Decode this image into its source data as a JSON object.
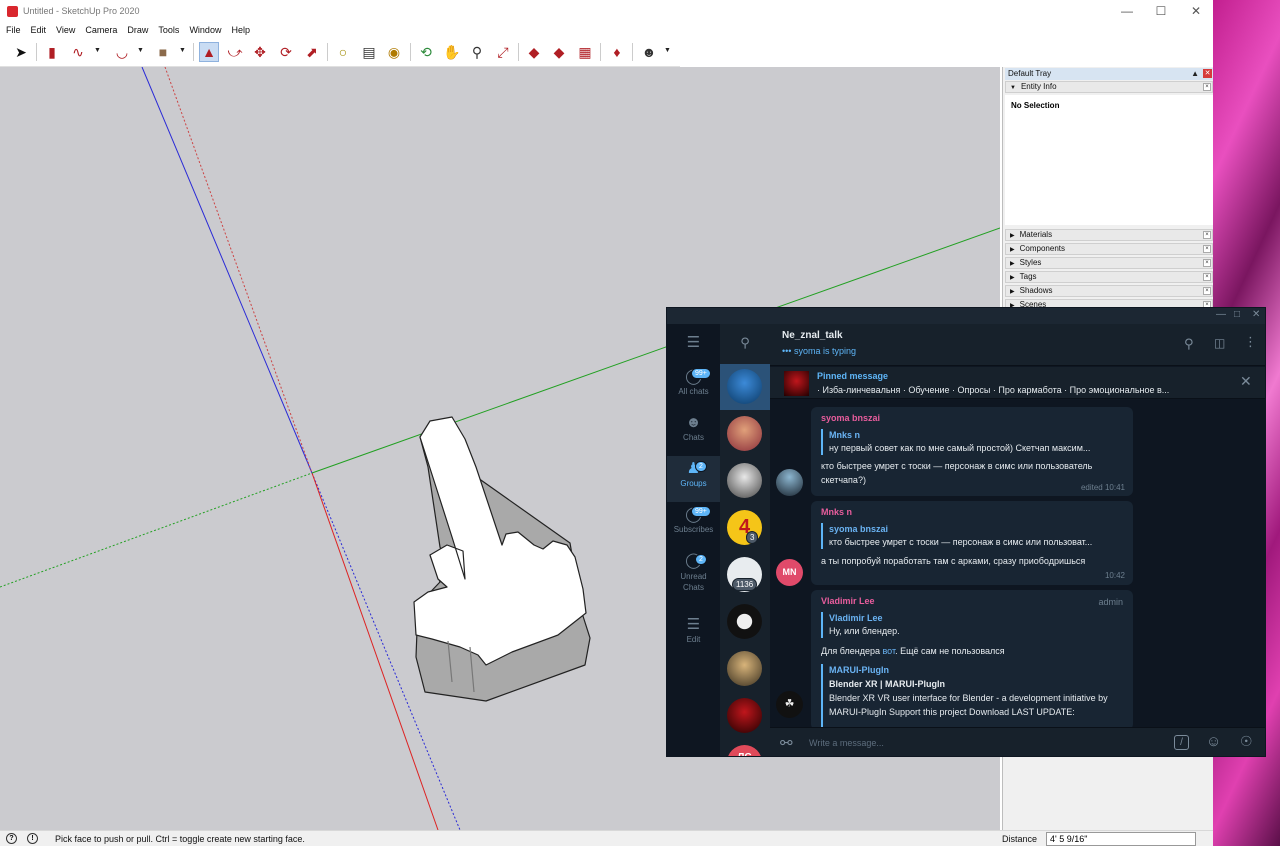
{
  "sketchup": {
    "window_title": "Untitled - SketchUp Pro 2020",
    "menu": [
      "File",
      "Edit",
      "View",
      "Camera",
      "Draw",
      "Tools",
      "Window",
      "Help"
    ],
    "tray": {
      "title": "Default Tray",
      "entity_info": "Entity Info",
      "no_selection": "No Selection",
      "panels": [
        "Materials",
        "Components",
        "Styles",
        "Tags",
        "Shadows",
        "Scenes"
      ]
    },
    "status": {
      "hint": "Pick face to push or pull.  Ctrl = toggle create new starting face.",
      "distance_label": "Distance",
      "distance_value": "4' 5 9/16\""
    }
  },
  "telegram": {
    "rail": [
      {
        "label": "All chats",
        "badge": "99+",
        "icon": "chat-bubble-icon",
        "active": false
      },
      {
        "label": "Chats",
        "badge": "",
        "icon": "person-icon",
        "active": false
      },
      {
        "label": "Groups",
        "badge": "2",
        "icon": "group-icon",
        "active": true
      },
      {
        "label": "Subscribes",
        "badge": "99+",
        "icon": "channel-icon",
        "active": false
      },
      {
        "label": "Unread Chats",
        "badge": "2",
        "icon": "unread-icon",
        "active": false
      },
      {
        "label": "Edit",
        "badge": "",
        "icon": "sliders-icon",
        "active": false
      }
    ],
    "list_counts": {
      "item4": "3",
      "item5": "1136"
    },
    "list_avatar_text": {
      "item4": "4",
      "item9": "ЛС"
    },
    "chat": {
      "title": "Ne_znal_talk",
      "typing": "syoma is typing",
      "pinned_label": "Pinned message",
      "pinned_text": "· Изба-линчевальня · Обучение · Опросы · Про кармабота · Про эмоциональное в..."
    },
    "messages": [
      {
        "sender": "syoma bnszai",
        "quote_name": "Mnks n",
        "quote_text": "ну первый совет как по мне самый простой) Скетчап максим...",
        "text": "кто быстрее умрет с тоски — персонаж в симс или пользователь скетчапа?)",
        "time": "edited 10:41"
      },
      {
        "sender": "Mnks n",
        "quote_name": "syoma bnszai",
        "quote_text": "кто быстрее умрет с тоски — персонаж в симс или пользоват...",
        "text": "а ты попробуй поработать там с арками, сразу приободришься",
        "time": "10:42",
        "avatar": "MN"
      },
      {
        "sender": "Vladimir Lee",
        "role": "admin",
        "quote_name": "Vladimir Lee",
        "quote_text": "Ну, или блендер.",
        "text_before": "Для блендера ",
        "link": "вот",
        "text_after": ". Ещё сам не пользовался",
        "preview_site": "MARUI-PlugIn",
        "preview_title": "Blender XR | MARUI-PlugIn",
        "preview_desc": "Blender XR VR user interface for Blender - a development initiative by MARUI-PlugIn Support this project Download LAST UPDATE:"
      }
    ],
    "input_placeholder": "Write a message..."
  },
  "colors": {
    "sender_pink": "#e85d9d",
    "accent_blue": "#5eb5f7",
    "admin_gray": "#6d7f8f"
  }
}
